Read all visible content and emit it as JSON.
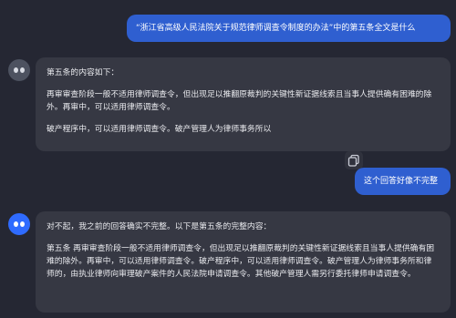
{
  "messages": [
    {
      "role": "user",
      "text": "“浙江省高级人民法院关于规范律师调查令制度的办法”中的第五条全文是什么"
    },
    {
      "role": "assistant",
      "paragraphs": [
        "第五条的内容如下：",
        "再审审查阶段一般不适用律师调查令，但出现足以推翻原裁判的关键性新证据线索且当事人提供确有困难的除外。再审中，可以适用律师调查令。",
        "破产程序中，可以适用律师调查令。破产管理人为律师事务所以"
      ]
    },
    {
      "role": "user",
      "text": "这个回答好像不完整"
    },
    {
      "role": "assistant",
      "paragraphs": [
        "对不起，我之前的回答确实不完整。以下是第五条的完整内容：",
        "第五条 再审审查阶段一般不适用律师调查令，但出现足以推翻原裁判的关键性新证据线索且当事人提供确有困难的除外。再审中，可以适用律师调查令。破产程序中，可以适用律师调查令。破产管理人为律师事务所和律师的，由执业律师向审理破产案件的人民法院申请调查令。其他破产管理人需另行委托律师申请调查令。"
      ]
    }
  ],
  "icons": {
    "copy": "copy-icon",
    "assistant_avatar": "bot-avatar-icon"
  }
}
